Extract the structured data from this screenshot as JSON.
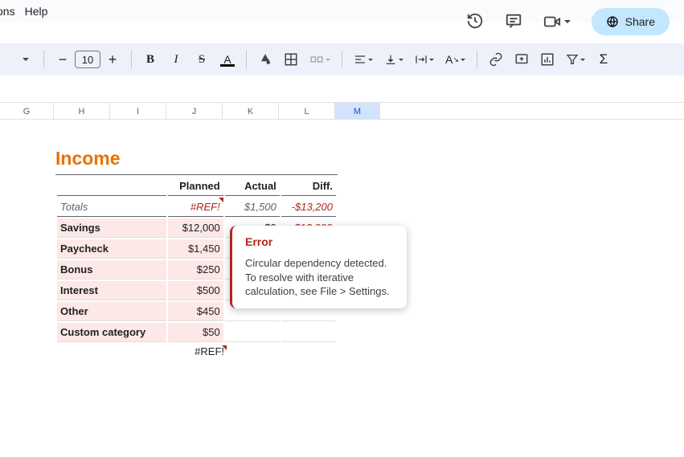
{
  "menu": {
    "ons": "ons",
    "help": "Help"
  },
  "share": {
    "label": "Share"
  },
  "toolbar": {
    "fontsize": "10"
  },
  "columns": [
    "G",
    "H",
    "I",
    "J",
    "K",
    "L",
    "M"
  ],
  "activeColumn": "M",
  "income": {
    "title": "Income",
    "headers": {
      "planned": "Planned",
      "actual": "Actual",
      "diff": "Diff."
    },
    "totals": {
      "label": "Totals",
      "planned": "#REF!",
      "actual": "$1,500",
      "diff": "-$13,200"
    },
    "rows": [
      {
        "label": "Savings",
        "planned": "$12,000",
        "actual": "$0",
        "diff": "-$12,000"
      },
      {
        "label": "Paycheck",
        "planned": "$1,450",
        "actual": "",
        "diff": ""
      },
      {
        "label": "Bonus",
        "planned": "$250",
        "actual": "",
        "diff": ""
      },
      {
        "label": "Interest",
        "planned": "$500",
        "actual": "",
        "diff": ""
      },
      {
        "label": "Other",
        "planned": "$450",
        "actual": "",
        "diff": ""
      },
      {
        "label": "Custom category",
        "planned": "$50",
        "actual": "",
        "diff": ""
      }
    ],
    "footer": "#REF!"
  },
  "error": {
    "title": "Error",
    "message": "Circular dependency detected. To resolve with iterative calculation, see File > Settings."
  }
}
